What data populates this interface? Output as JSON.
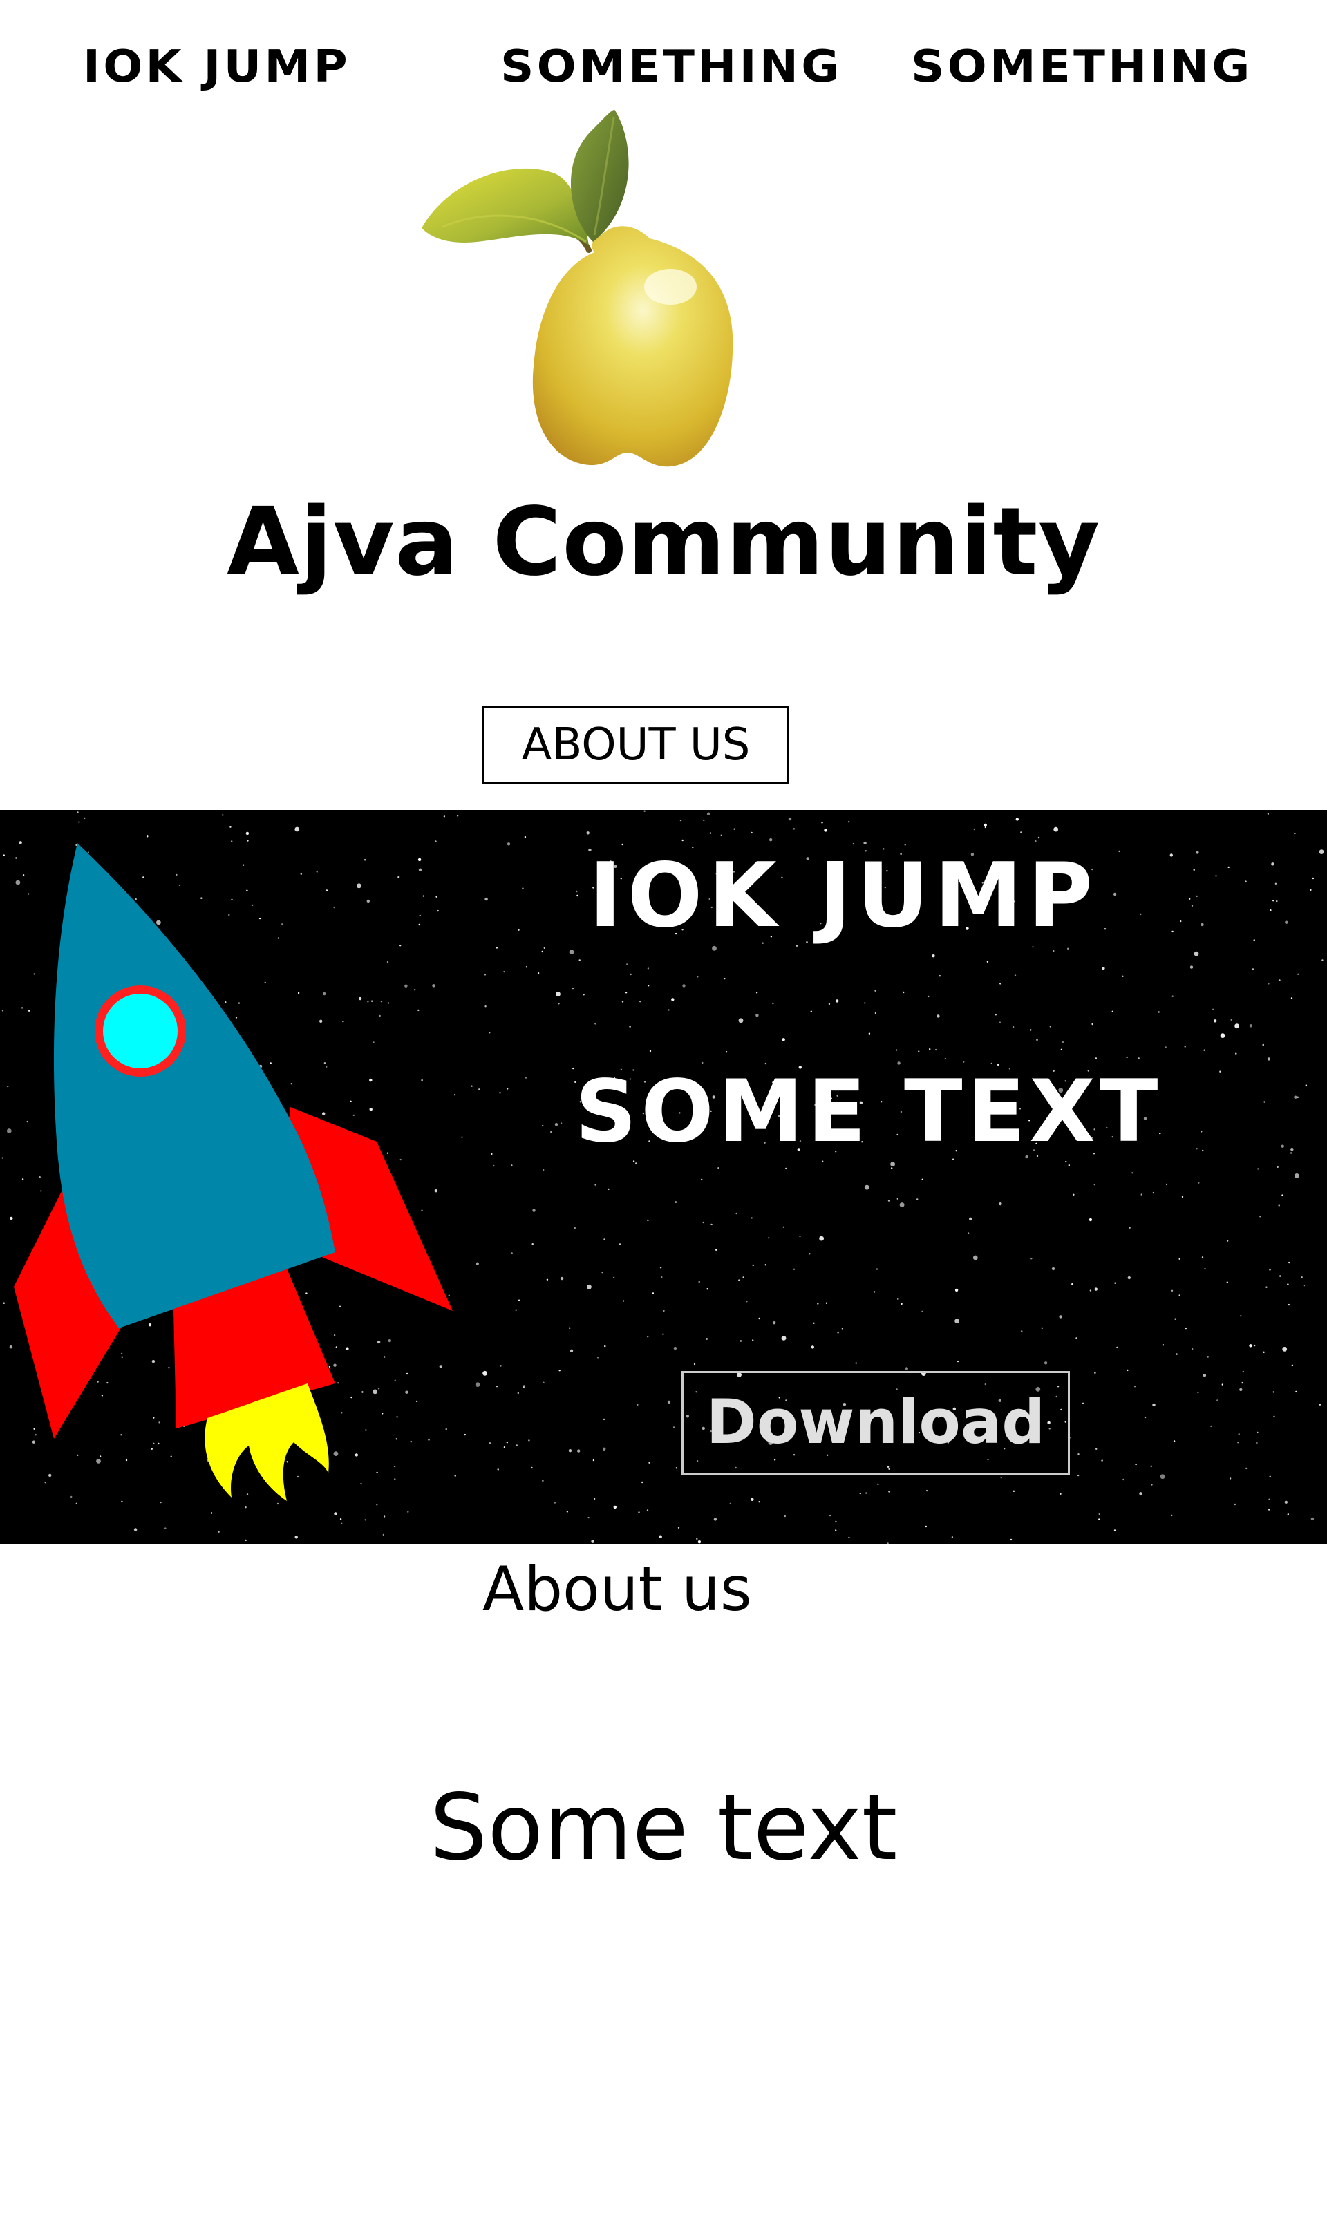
{
  "nav": {
    "items": [
      {
        "label": "IOK JUMP"
      },
      {
        "label": "SOMETHING"
      },
      {
        "label": "SOMETHING"
      }
    ]
  },
  "brand": {
    "logo_icon": "quince-fruit-icon",
    "title": "Ajva Community"
  },
  "about_button": {
    "label": "ABOUT US"
  },
  "hero": {
    "background": "starfield",
    "illustration": "rocket-icon",
    "title": "IOK JUMP",
    "subtitle": "SOME TEXT",
    "download_label": "Download"
  },
  "about_section": {
    "heading": "About us",
    "body": "Some text"
  },
  "colors": {
    "page_background": "#ffffff",
    "hero_background": "#000000",
    "rocket_body": "#0086a8",
    "rocket_fins": "#ff0000",
    "rocket_window": "#00ffff",
    "flame": "#ffff00",
    "logo_fruit": "#e8c53a",
    "logo_leaf": "#b9c93a"
  }
}
